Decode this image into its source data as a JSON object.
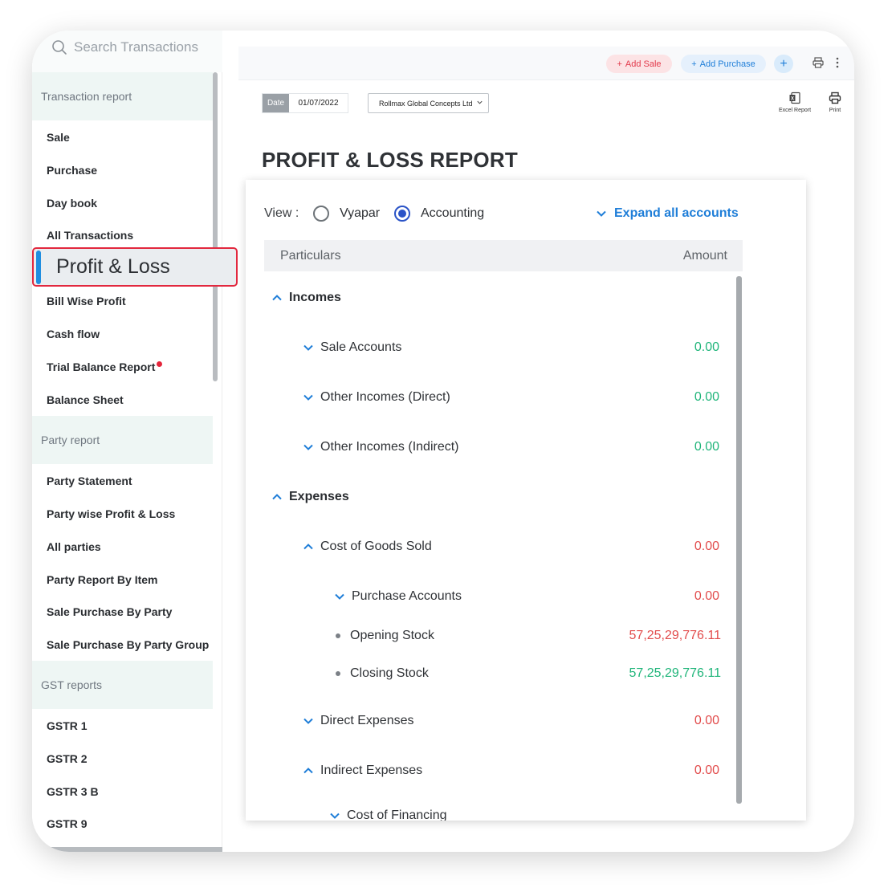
{
  "search": {
    "placeholder": "Search Transactions"
  },
  "sidebar": {
    "sections": [
      {
        "title": "Transaction report"
      },
      {
        "title": "Party report"
      },
      {
        "title": "GST reports"
      }
    ],
    "transaction_items": [
      "Sale",
      "Purchase",
      "Day book",
      "All Transactions"
    ],
    "active_item": "Profit & Loss",
    "after_active_items": [
      "Bill Wise Profit",
      "Cash flow",
      "Trial Balance Report",
      "Balance Sheet"
    ],
    "party_items": [
      "Party Statement",
      "Party wise Profit & Loss",
      "All parties",
      "Party Report By Item",
      "Sale Purchase By Party",
      "Sale Purchase By Party Group"
    ],
    "gst_items": [
      "GSTR 1",
      "GSTR 2",
      "GSTR 3 B",
      "GSTR 9"
    ]
  },
  "topbar": {
    "add_sale": "Add Sale",
    "add_purchase": "Add Purchase",
    "plus": "+"
  },
  "filters": {
    "date_label": "Date",
    "date_value": "01/07/2022",
    "firm": "Rollmax Global Concepts Ltd"
  },
  "tools": {
    "excel": "Excel Report",
    "print": "Print"
  },
  "report": {
    "title": "PROFIT & LOSS REPORT",
    "view_label": "View :",
    "view_options": [
      "Vyapar",
      "Accounting"
    ],
    "view_selected": "Accounting",
    "expand_all": "Expand all accounts",
    "columns": {
      "particulars": "Particulars",
      "amount": "Amount"
    },
    "incomes": {
      "label": "Incomes",
      "rows": [
        {
          "label": "Sale Accounts",
          "amount": "0.00"
        },
        {
          "label": "Other Incomes (Direct)",
          "amount": "0.00"
        },
        {
          "label": "Other Incomes (Indirect)",
          "amount": "0.00"
        }
      ]
    },
    "expenses": {
      "label": "Expenses",
      "cogs": {
        "label": "Cost of Goods Sold",
        "amount": "0.00"
      },
      "purchase_accounts": {
        "label": "Purchase Accounts",
        "amount": "0.00"
      },
      "opening_stock": {
        "label": "Opening Stock",
        "amount": "57,25,29,776.11"
      },
      "closing_stock": {
        "label": "Closing Stock",
        "amount": "57,25,29,776.11"
      },
      "direct_expenses": {
        "label": "Direct Expenses",
        "amount": "0.00"
      },
      "indirect_expenses": {
        "label": "Indirect Expenses",
        "amount": "0.00"
      },
      "cost_of_financing": {
        "label": "Cost of Financing"
      }
    },
    "colors": {
      "income": "#20b57a",
      "expense": "#e24c4c",
      "accent": "#1f7ed8"
    }
  }
}
